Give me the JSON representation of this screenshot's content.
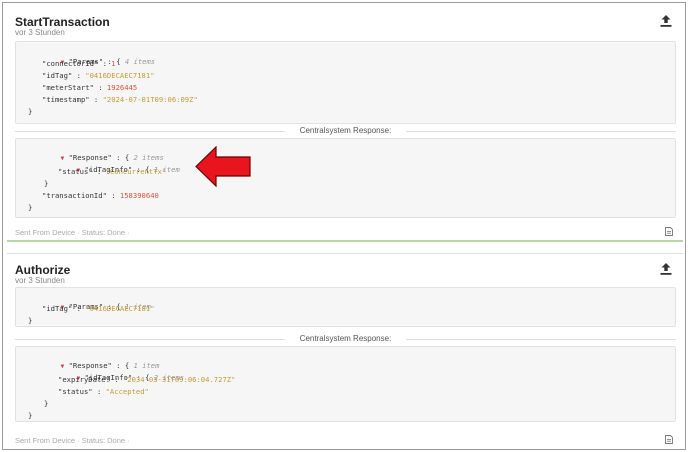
{
  "cards": [
    {
      "title": "StartTransaction",
      "time": "vor 3 Stunden",
      "params_key": "\"Params\"",
      "params_meta": "4 items",
      "params": [
        {
          "key": "\"connectorId\"",
          "value": "1",
          "kind": "num"
        },
        {
          "key": "\"idTag\"",
          "value": "\"0416DECAEC7181\"",
          "kind": "str"
        },
        {
          "key": "\"meterStart\"",
          "value": "1926445",
          "kind": "num"
        },
        {
          "key": "\"timestamp\"",
          "value": "\"2024-07-01T09:06:09Z\"",
          "kind": "str"
        }
      ],
      "response_label": "Centralsystem Response:",
      "response_key": "\"Response\"",
      "response_meta": "2 items",
      "idtaginfo_key": "\"idTagInfo\"",
      "idtaginfo_meta": "1 item",
      "idtaginfo": [
        {
          "key": "\"status\"",
          "value": "\"ConcurrentTx\"",
          "kind": "str"
        }
      ],
      "extra_key": "\"transactionId\"",
      "extra_value": "158390640",
      "footer": "Sent From Device · Status: Done ·"
    },
    {
      "title": "Authorize",
      "time": "vor 3 Stunden",
      "params_key": "\"Params\"",
      "params_meta": "1 item",
      "params": [
        {
          "key": "\"idTag\"",
          "value": "\"0416DECAEC7181\"",
          "kind": "str"
        }
      ],
      "response_label": "Centralsystem Response:",
      "response_key": "\"Response\"",
      "response_meta": "1 item",
      "idtaginfo_key": "\"idTagInfo\"",
      "idtaginfo_meta": "2 items",
      "idtaginfo": [
        {
          "key": "\"expiryDate\"",
          "value": "\"2034-03-31T09:06:04.727Z\"",
          "kind": "str"
        },
        {
          "key": "\"status\"",
          "value": "\"Accepted\"",
          "kind": "str"
        }
      ],
      "footer": "Sent From Device · Status: Done ·"
    }
  ],
  "symbols": {
    "colon": " : ",
    "open": "{",
    "close": "}"
  },
  "colors": {
    "accent_arrow": "#e8141e",
    "card_divider": "#b9d6a8"
  },
  "icons": {
    "upload": "upload-icon",
    "document": "document-icon",
    "caret": "caret-down-icon"
  }
}
